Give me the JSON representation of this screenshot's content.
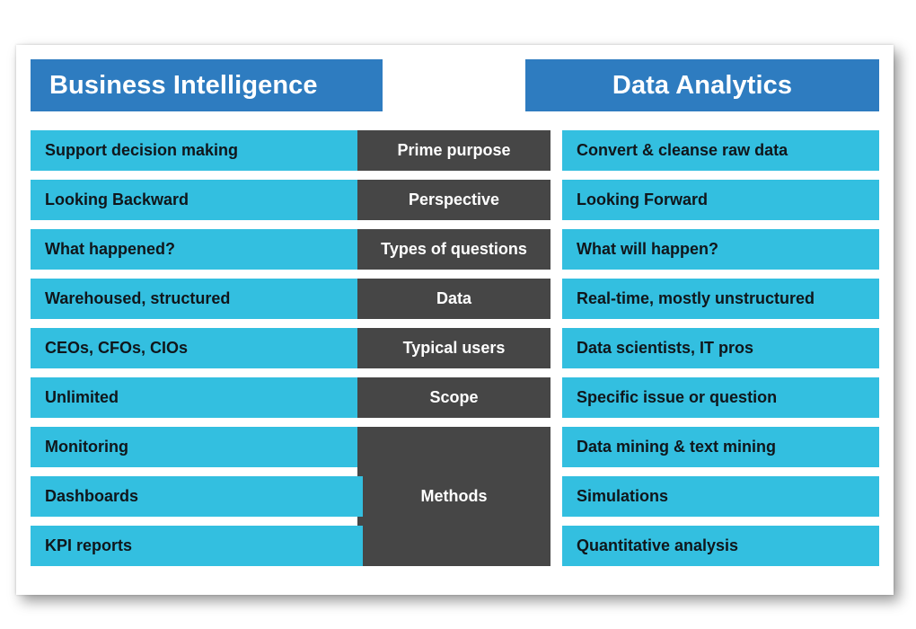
{
  "card": {
    "background_color": "#ffffff",
    "page_background_color": "#ffffff"
  },
  "colors": {
    "header_blue": "#2E7CC0",
    "row_cyan": "#33BFE0",
    "center_gray": "#464646",
    "row_text": "#10161b",
    "header_text": "#ffffff",
    "center_text": "#ffffff"
  },
  "header": {
    "left_title": "Business Intelligence",
    "right_title": "Data Analytics"
  },
  "comparison": {
    "rows": [
      {
        "attribute": "Prime purpose",
        "business_intelligence": "Support decision making",
        "data_analytics": "Convert & cleanse raw data"
      },
      {
        "attribute": "Perspective",
        "business_intelligence": "Looking Backward",
        "data_analytics": "Looking Forward"
      },
      {
        "attribute": "Types of questions",
        "business_intelligence": "What happened?",
        "data_analytics": "What will happen?"
      },
      {
        "attribute": "Data",
        "business_intelligence": "Warehoused, structured",
        "data_analytics": "Real-time, mostly unstructured"
      },
      {
        "attribute": "Typical users",
        "business_intelligence": "CEOs, CFOs, CIOs",
        "data_analytics": "Data scientists, IT pros"
      },
      {
        "attribute": "Scope",
        "business_intelligence": "Unlimited",
        "data_analytics": "Specific issue or question"
      },
      {
        "attribute": "Methods",
        "attribute_spans_rows": 3,
        "business_intelligence": "Monitoring",
        "data_analytics": "Data mining & text mining"
      },
      {
        "attribute": null,
        "business_intelligence": "Dashboards",
        "data_analytics": "Simulations"
      },
      {
        "attribute": null,
        "business_intelligence": "KPI reports",
        "data_analytics": "Quantitative analysis"
      }
    ]
  }
}
